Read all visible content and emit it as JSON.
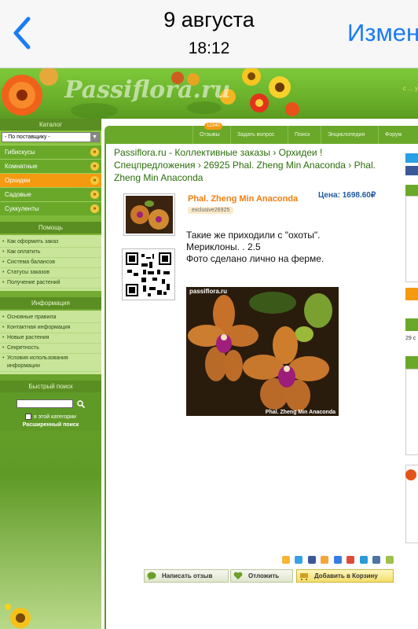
{
  "ios": {
    "date": "9 августа",
    "time": "18:12",
    "edit_label": "Измен"
  },
  "site": {
    "logo": "Passiflora.ru",
    "banner_right": "с ... у"
  },
  "sidebar": {
    "catalog_title": "Каталог",
    "select_value": "- По поставщику -",
    "categories": [
      {
        "label": "Гибискусы"
      },
      {
        "label": "Комнатные"
      },
      {
        "label": "Орхидеи"
      },
      {
        "label": "Садовые"
      },
      {
        "label": "Суккуленты"
      }
    ],
    "help_title": "Помощь",
    "help_links": [
      "Как оформить заказ",
      "Как оплатить",
      "Система балансов",
      "Статусы заказов",
      "Получение растений"
    ],
    "info_title": "Информация",
    "info_links": [
      "Основные правила",
      "Контактная информация",
      "Новые растения",
      "Секретность",
      "Условия использования информации"
    ],
    "search_title": "Быстрый поиск",
    "in_category_label": "в этой категории",
    "advanced_search": "Расширенный поиск"
  },
  "topnav": {
    "badge": "12340",
    "items": [
      "Отзывы",
      "Задать вопрос",
      "Поиск",
      "Энциклопедия",
      "Форум"
    ]
  },
  "product": {
    "breadcrumb": "Passiflora.ru - Коллективные заказы › Орхидеи ! Спецпредложения › 26925 Phal. Zheng Min Anaconda › Phal. Zheng Min Anaconda",
    "title": "Phal. Zheng Min Anaconda",
    "sku": "exclusive26925",
    "price": "Цена: 1698.60₽",
    "description_lines": [
      "Такие же приходили с \"охоты\".",
      "Мериклоны. . 2.5",
      "Фото сделано лично на ферме."
    ],
    "photo_brand": "passiflora.ru",
    "photo_caption": "Phal. Zheng Min Anaconda"
  },
  "actions": {
    "review": "Написать отзыв",
    "defer": "Отложить",
    "cart": "Добавить в Корзину"
  },
  "right_strip": {
    "count_text": "29 с"
  },
  "colors": {
    "ios_blue": "#1a7cf5",
    "site_green": "#6aa82a",
    "active_orange": "#f49a10",
    "link_green": "#2a6e0a",
    "price_blue": "#1e5aa0"
  }
}
